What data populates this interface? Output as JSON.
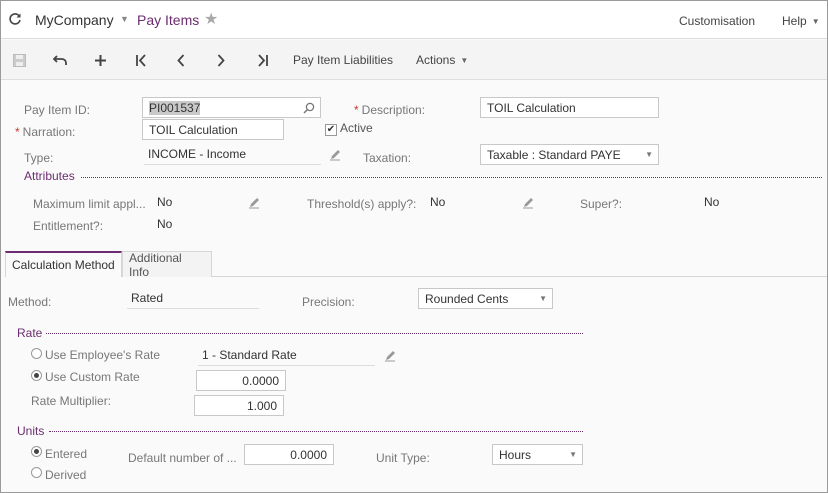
{
  "header": {
    "company": "MyCompany",
    "screen_title": "Pay Items",
    "customisation": "Customisation",
    "help": "Help"
  },
  "toolbar": {
    "liabilities": "Pay Item Liabilities",
    "actions": "Actions"
  },
  "form": {
    "pay_item_id_label": "Pay Item ID:",
    "pay_item_id": "PI001537",
    "description_label": "Description:",
    "description": "TOIL Calculation",
    "narration_label": "Narration:",
    "narration": "TOIL Calculation",
    "active_label": "Active",
    "type_label": "Type:",
    "type": "INCOME - Income",
    "taxation_label": "Taxation:",
    "taxation": "Taxable : Standard PAYE"
  },
  "attributes": {
    "title": "Attributes",
    "max_limit_label": "Maximum limit appl...",
    "max_limit": "No",
    "threshold_label": "Threshold(s) apply?:",
    "threshold": "No",
    "super_label": "Super?:",
    "super": "No",
    "entitlement_label": "Entitlement?:",
    "entitlement": "No"
  },
  "tabs": [
    {
      "label": "Calculation Method"
    },
    {
      "label": "Additional Info"
    }
  ],
  "calc": {
    "method_label": "Method:",
    "method": "Rated",
    "precision_label": "Precision:",
    "precision": "Rounded Cents",
    "rate_title": "Rate",
    "use_employee_rate": "Use Employee's Rate",
    "employee_rate": "1 - Standard Rate",
    "use_custom_rate": "Use Custom Rate",
    "custom_rate": "0.0000",
    "multiplier_label": "Rate Multiplier:",
    "multiplier": "1.000",
    "units_title": "Units",
    "entered": "Entered",
    "derived": "Derived",
    "default_units_label": "Default number of ...",
    "default_units": "0.0000",
    "unit_type_label": "Unit Type:",
    "unit_type": "Hours"
  },
  "colors": {
    "accent": "#6b2d6f",
    "required": "#c0392b"
  },
  "icons": [
    "refresh-icon",
    "star-icon",
    "save-icon",
    "undo-icon",
    "add-icon",
    "first-icon",
    "prev-icon",
    "next-icon",
    "last-icon",
    "search-icon",
    "pencil-icon"
  ]
}
